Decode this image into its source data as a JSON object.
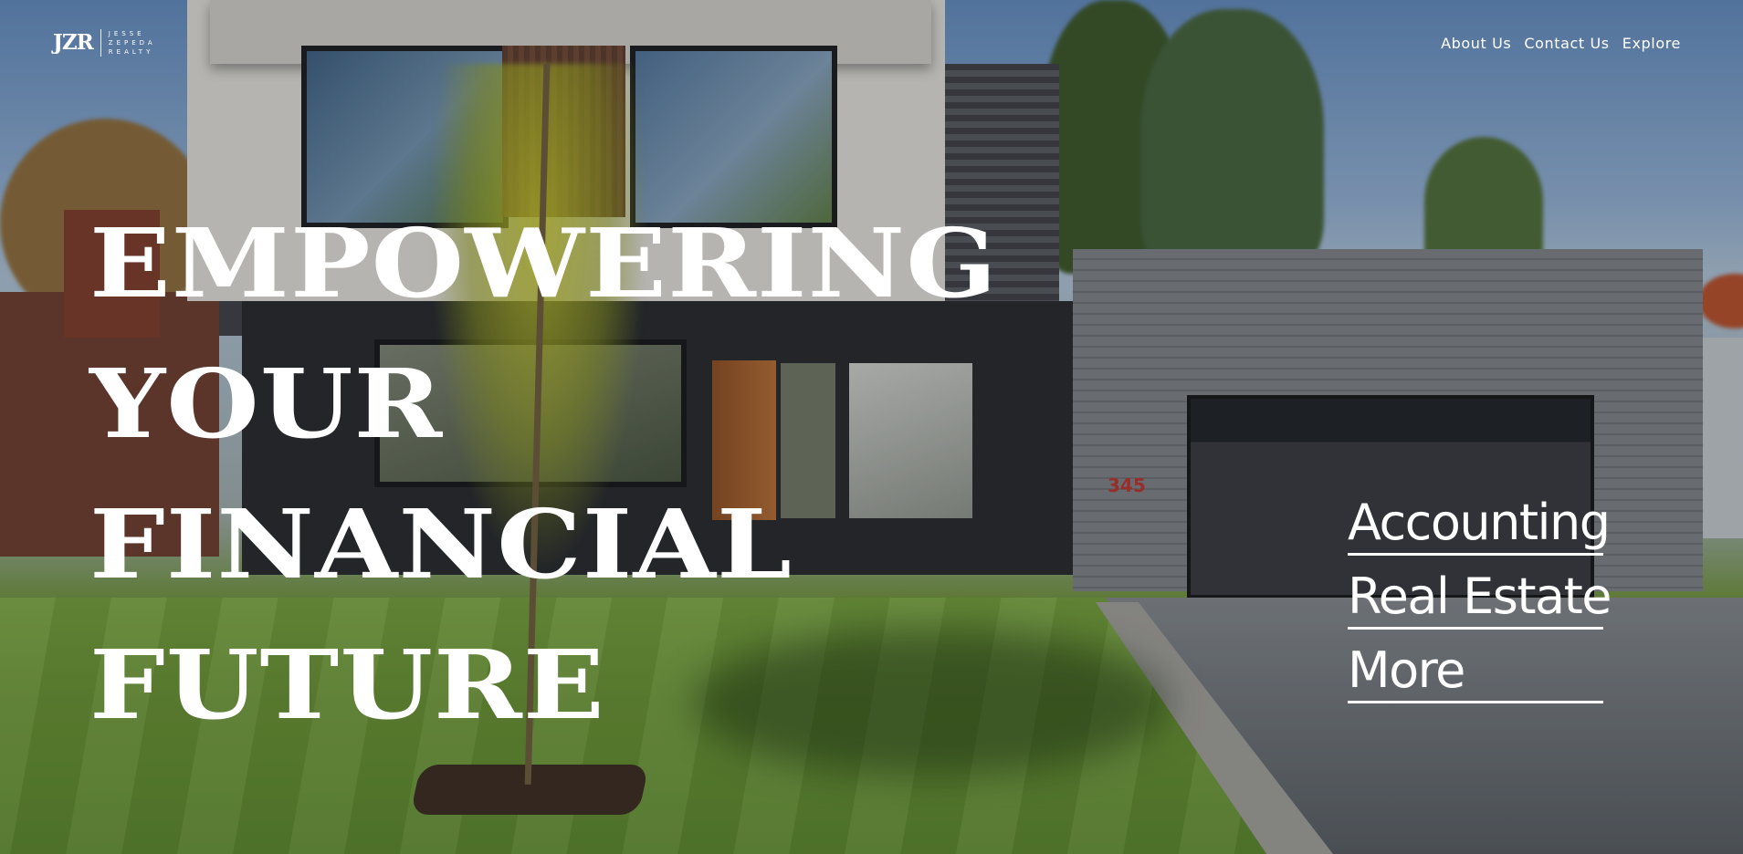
{
  "brand": {
    "mark": "JZR",
    "words": [
      "JESSE",
      "ZEPEDA",
      "REALTY"
    ]
  },
  "nav": {
    "items": [
      {
        "label": "About Us"
      },
      {
        "label": "Contact Us"
      },
      {
        "label": "Explore"
      }
    ]
  },
  "hero": {
    "headline_lines": [
      "EMPOWERING",
      "YOUR",
      "FINANCIAL",
      "FUTURE"
    ],
    "house_number": "345",
    "background_description_icon": "house-photo"
  },
  "services": {
    "items": [
      {
        "label": "Accounting"
      },
      {
        "label": "Real Estate"
      },
      {
        "label": "More"
      }
    ]
  },
  "colors": {
    "text": "#ffffff",
    "house_number": "#b5322b"
  }
}
